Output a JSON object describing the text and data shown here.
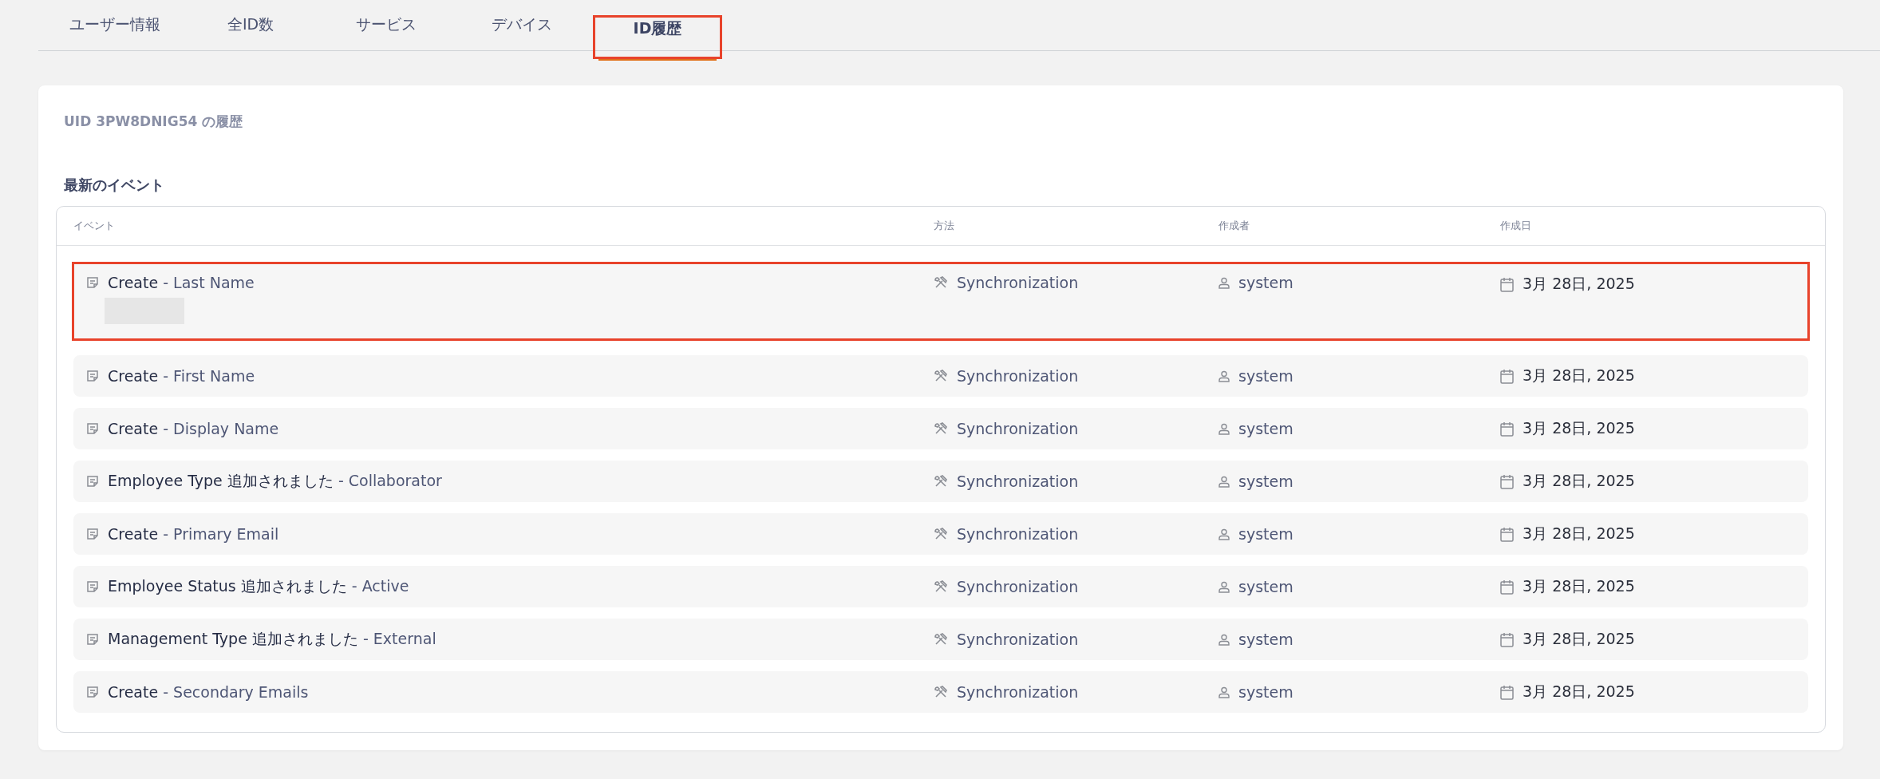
{
  "tabs": [
    {
      "label": "ユーザー情報",
      "selected": false,
      "annotated": false
    },
    {
      "label": "全ID数",
      "selected": false,
      "annotated": false
    },
    {
      "label": "サービス",
      "selected": false,
      "annotated": false
    },
    {
      "label": "デバイス",
      "selected": false,
      "annotated": false
    },
    {
      "label": "ID履歴",
      "selected": true,
      "annotated": true
    }
  ],
  "card": {
    "title": "UID 3PW8DNIG54 の履歴",
    "section_title": "最新のイベント"
  },
  "table": {
    "columns": [
      "イベント",
      "方法",
      "作成者",
      "作成日"
    ],
    "rows": [
      {
        "action": "Create",
        "detail": "- Last Name",
        "method": "Synchronization",
        "author": "system",
        "date": "3月 28日, 2025",
        "redacted": true,
        "annotated": true
      },
      {
        "action": "Create",
        "detail": "- First Name",
        "method": "Synchronization",
        "author": "system",
        "date": "3月 28日, 2025",
        "redacted": false,
        "annotated": false
      },
      {
        "action": "Create",
        "detail": "- Display Name",
        "method": "Synchronization",
        "author": "system",
        "date": "3月 28日, 2025",
        "redacted": false,
        "annotated": false
      },
      {
        "action": "Employee Type 追加されました",
        "detail": "- Collaborator",
        "method": "Synchronization",
        "author": "system",
        "date": "3月 28日, 2025",
        "redacted": false,
        "annotated": false
      },
      {
        "action": "Create",
        "detail": "- Primary Email",
        "method": "Synchronization",
        "author": "system",
        "date": "3月 28日, 2025",
        "redacted": false,
        "annotated": false
      },
      {
        "action": "Employee Status 追加されました",
        "detail": "- Active",
        "method": "Synchronization",
        "author": "system",
        "date": "3月 28日, 2025",
        "redacted": false,
        "annotated": false
      },
      {
        "action": "Management Type 追加されました",
        "detail": "- External",
        "method": "Synchronization",
        "author": "system",
        "date": "3月 28日, 2025",
        "redacted": false,
        "annotated": false
      },
      {
        "action": "Create",
        "detail": "- Secondary Emails",
        "method": "Synchronization",
        "author": "system",
        "date": "3月 28日, 2025",
        "redacted": false,
        "annotated": false
      }
    ]
  }
}
